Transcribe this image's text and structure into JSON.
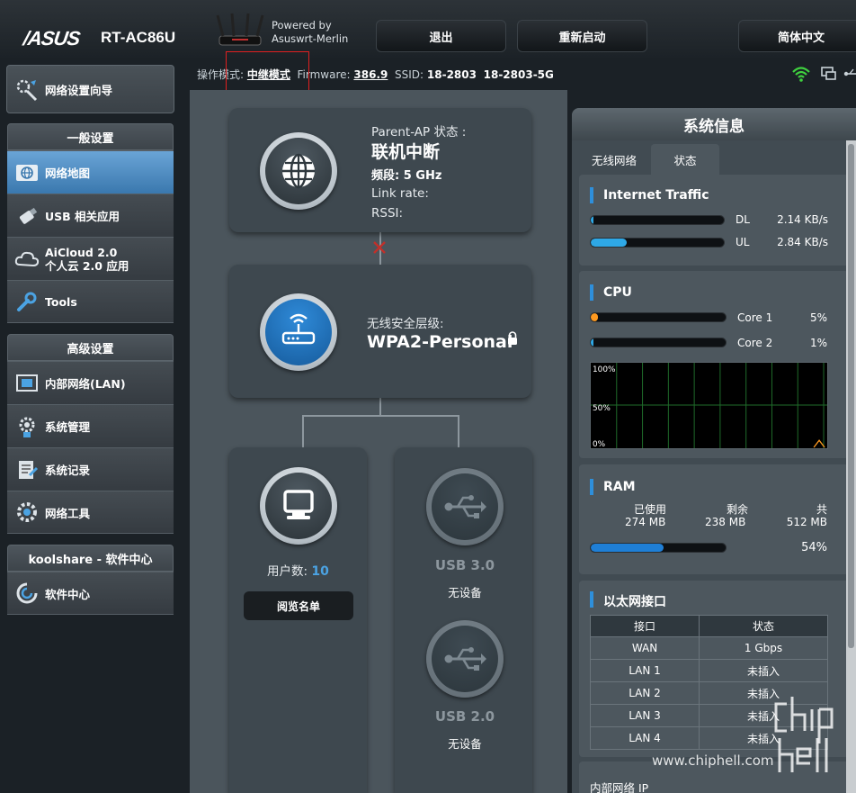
{
  "header": {
    "logo": "/ASUS",
    "model": "RT-AC86U",
    "powered_line1": "Powered by",
    "powered_line2": "Asuswrt-Merlin",
    "logout_label": "退出",
    "reboot_label": "重新启动",
    "language_label": "简体中文"
  },
  "status_bar": {
    "op_mode_label": "操作模式:",
    "op_mode_value": "中继模式",
    "firmware_label": "Firmware:",
    "firmware_value": "386.9",
    "ssid_label": "SSID:",
    "ssid_value_1": "18-2803",
    "ssid_value_2": "18-2803-5G",
    "icons": [
      "wifi-icon",
      "monitor-icon",
      "usb-icon"
    ]
  },
  "sidebar": {
    "wizard_label": "网络设置向导",
    "general_header": "一般设置",
    "general_items": [
      {
        "label": "网络地图",
        "icon": "globe-icon",
        "active": true
      },
      {
        "label": "USB 相关应用",
        "icon": "usb-stick-icon"
      },
      {
        "label": "AiCloud 2.0",
        "sublabel": "个人云 2.0 应用",
        "icon": "cloud-icon"
      },
      {
        "label": "Tools",
        "icon": "wrench-icon"
      }
    ],
    "advanced_header": "高级设置",
    "advanced_items": [
      {
        "label": "内部网络(LAN)",
        "icon": "lan-icon"
      },
      {
        "label": "系统管理",
        "icon": "admin-gear-icon"
      },
      {
        "label": "系统记录",
        "icon": "log-icon"
      },
      {
        "label": "网络工具",
        "icon": "tools-gear-icon"
      }
    ],
    "koolshare_header": "koolshare - 软件中心",
    "koolshare_items": [
      {
        "label": "软件中心",
        "icon": "software-center-icon"
      }
    ]
  },
  "network_map": {
    "parent_ap": {
      "status_label": "Parent-AP 状态 :",
      "status_value": "联机中断",
      "band_label": "频段: 5 GHz",
      "link_rate_label": "Link rate:",
      "rssi_label": "RSSI:"
    },
    "router": {
      "security_label": "无线安全层级:",
      "security_value": "WPA2-Personal"
    },
    "clients": {
      "count_label": "用户数:",
      "count_value": "10",
      "view_list_label": "阅览名单"
    },
    "usb3": {
      "title": "USB 3.0",
      "status": "无设备"
    },
    "usb2": {
      "title": "USB 2.0",
      "status": "无设备"
    }
  },
  "system_info": {
    "title": "系统信息",
    "tabs": [
      "无线网络",
      "状态"
    ],
    "active_tab": "状态",
    "internet_traffic": {
      "title": "Internet Traffic",
      "dl_label": "DL",
      "dl_value": "2.14 KB/s",
      "ul_label": "UL",
      "ul_value": "2.84 KB/s",
      "dl_fraction": 0.01,
      "ul_fraction": 0.27
    },
    "cpu": {
      "title": "CPU",
      "cores": [
        {
          "label": "Core 1",
          "value": "5%",
          "fraction": 0.05
        },
        {
          "label": "Core 2",
          "value": "1%",
          "fraction": 0.01
        }
      ],
      "graph_labels": [
        "100%",
        "50%",
        "0%"
      ]
    },
    "ram": {
      "title": "RAM",
      "used_label": "已使用",
      "used_value": "274 MB",
      "free_label": "剩余",
      "free_value": "238 MB",
      "total_label": "共",
      "total_value": "512 MB",
      "percent": "54%",
      "fraction": 0.54
    },
    "ethernet": {
      "title": "以太网接口",
      "headers": [
        "接口",
        "状态"
      ],
      "rows": [
        [
          "WAN",
          "1 Gbps"
        ],
        [
          "LAN 1",
          "未插入"
        ],
        [
          "LAN 2",
          "未插入"
        ],
        [
          "LAN 3",
          "未插入"
        ],
        [
          "LAN 4",
          "未插入"
        ]
      ]
    },
    "lan_ip_label": "内部网络 IP"
  },
  "watermark": {
    "text": "www.chiphell.com",
    "brand": "chip hell"
  },
  "colors": {
    "accent_blue": "#2e8fdb",
    "alert_red": "#e02020",
    "wifi_green": "#3fd13f",
    "bar_blue": "#2ea8e6"
  }
}
